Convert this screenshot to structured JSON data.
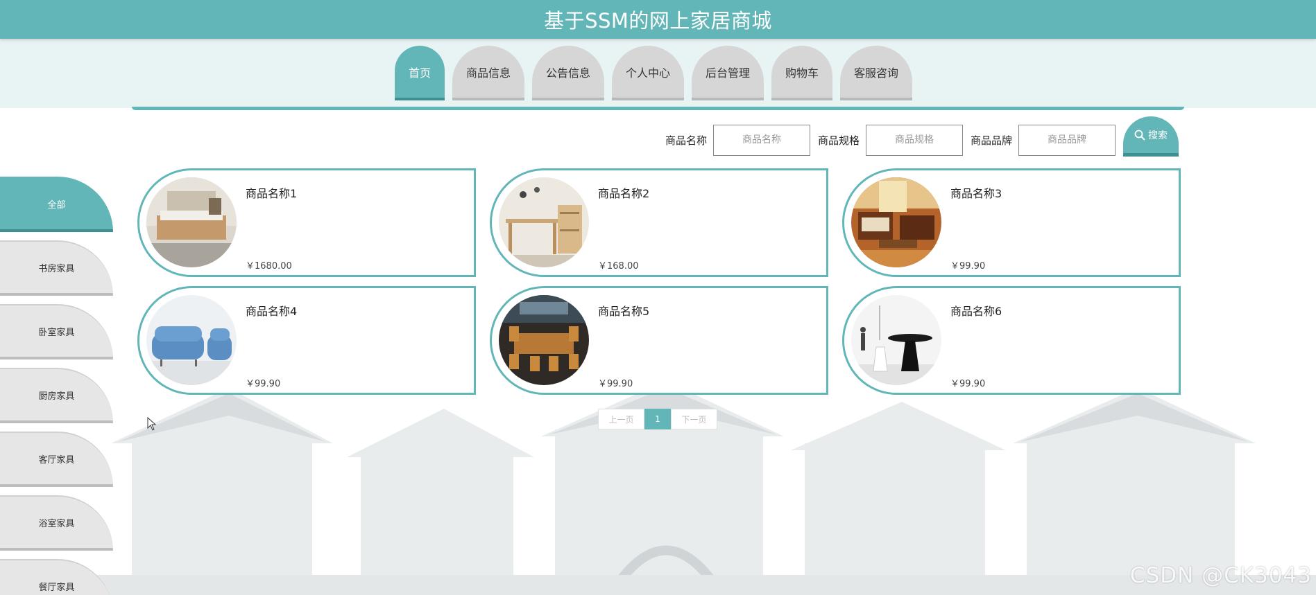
{
  "site_title": "基于SSM的网上家居商城",
  "nav": [
    {
      "label": "首页",
      "active": true
    },
    {
      "label": "商品信息",
      "active": false
    },
    {
      "label": "公告信息",
      "active": false
    },
    {
      "label": "个人中心",
      "active": false
    },
    {
      "label": "后台管理",
      "active": false
    },
    {
      "label": "购物车",
      "active": false
    },
    {
      "label": "客服咨询",
      "active": false
    }
  ],
  "search": {
    "name_label": "商品名称",
    "name_placeholder": "商品名称",
    "spec_label": "商品规格",
    "spec_placeholder": "商品规格",
    "brand_label": "商品品牌",
    "brand_placeholder": "商品品牌",
    "button_label": "搜索",
    "button_icon": "search-icon"
  },
  "categories": [
    {
      "label": "全部",
      "active": true
    },
    {
      "label": "书房家具",
      "active": false
    },
    {
      "label": "卧室家具",
      "active": false
    },
    {
      "label": "厨房家具",
      "active": false
    },
    {
      "label": "客厅家具",
      "active": false
    },
    {
      "label": "浴室家具",
      "active": false
    },
    {
      "label": "餐厅家具",
      "active": false
    }
  ],
  "products": [
    {
      "name": "商品名称1",
      "price": "￥1680.00",
      "image": "bedroom-bed-photo"
    },
    {
      "name": "商品名称2",
      "price": "￥168.00",
      "image": "study-desk-photo"
    },
    {
      "name": "商品名称3",
      "price": "￥99.90",
      "image": "livingroom-sofa-set-photo"
    },
    {
      "name": "商品名称4",
      "price": "￥99.90",
      "image": "blue-sofa-photo"
    },
    {
      "name": "商品名称5",
      "price": "￥99.90",
      "image": "dining-table-photo"
    },
    {
      "name": "商品名称6",
      "price": "￥99.90",
      "image": "side-table-photo"
    }
  ],
  "pagination": {
    "prev": "上一页",
    "current": "1",
    "next": "下一页"
  },
  "watermark": "CSDN @CK3043",
  "colors": {
    "accent": "#62b6b7",
    "accent_dark": "#3f8e90",
    "tab_inactive": "#d6d6d6"
  }
}
